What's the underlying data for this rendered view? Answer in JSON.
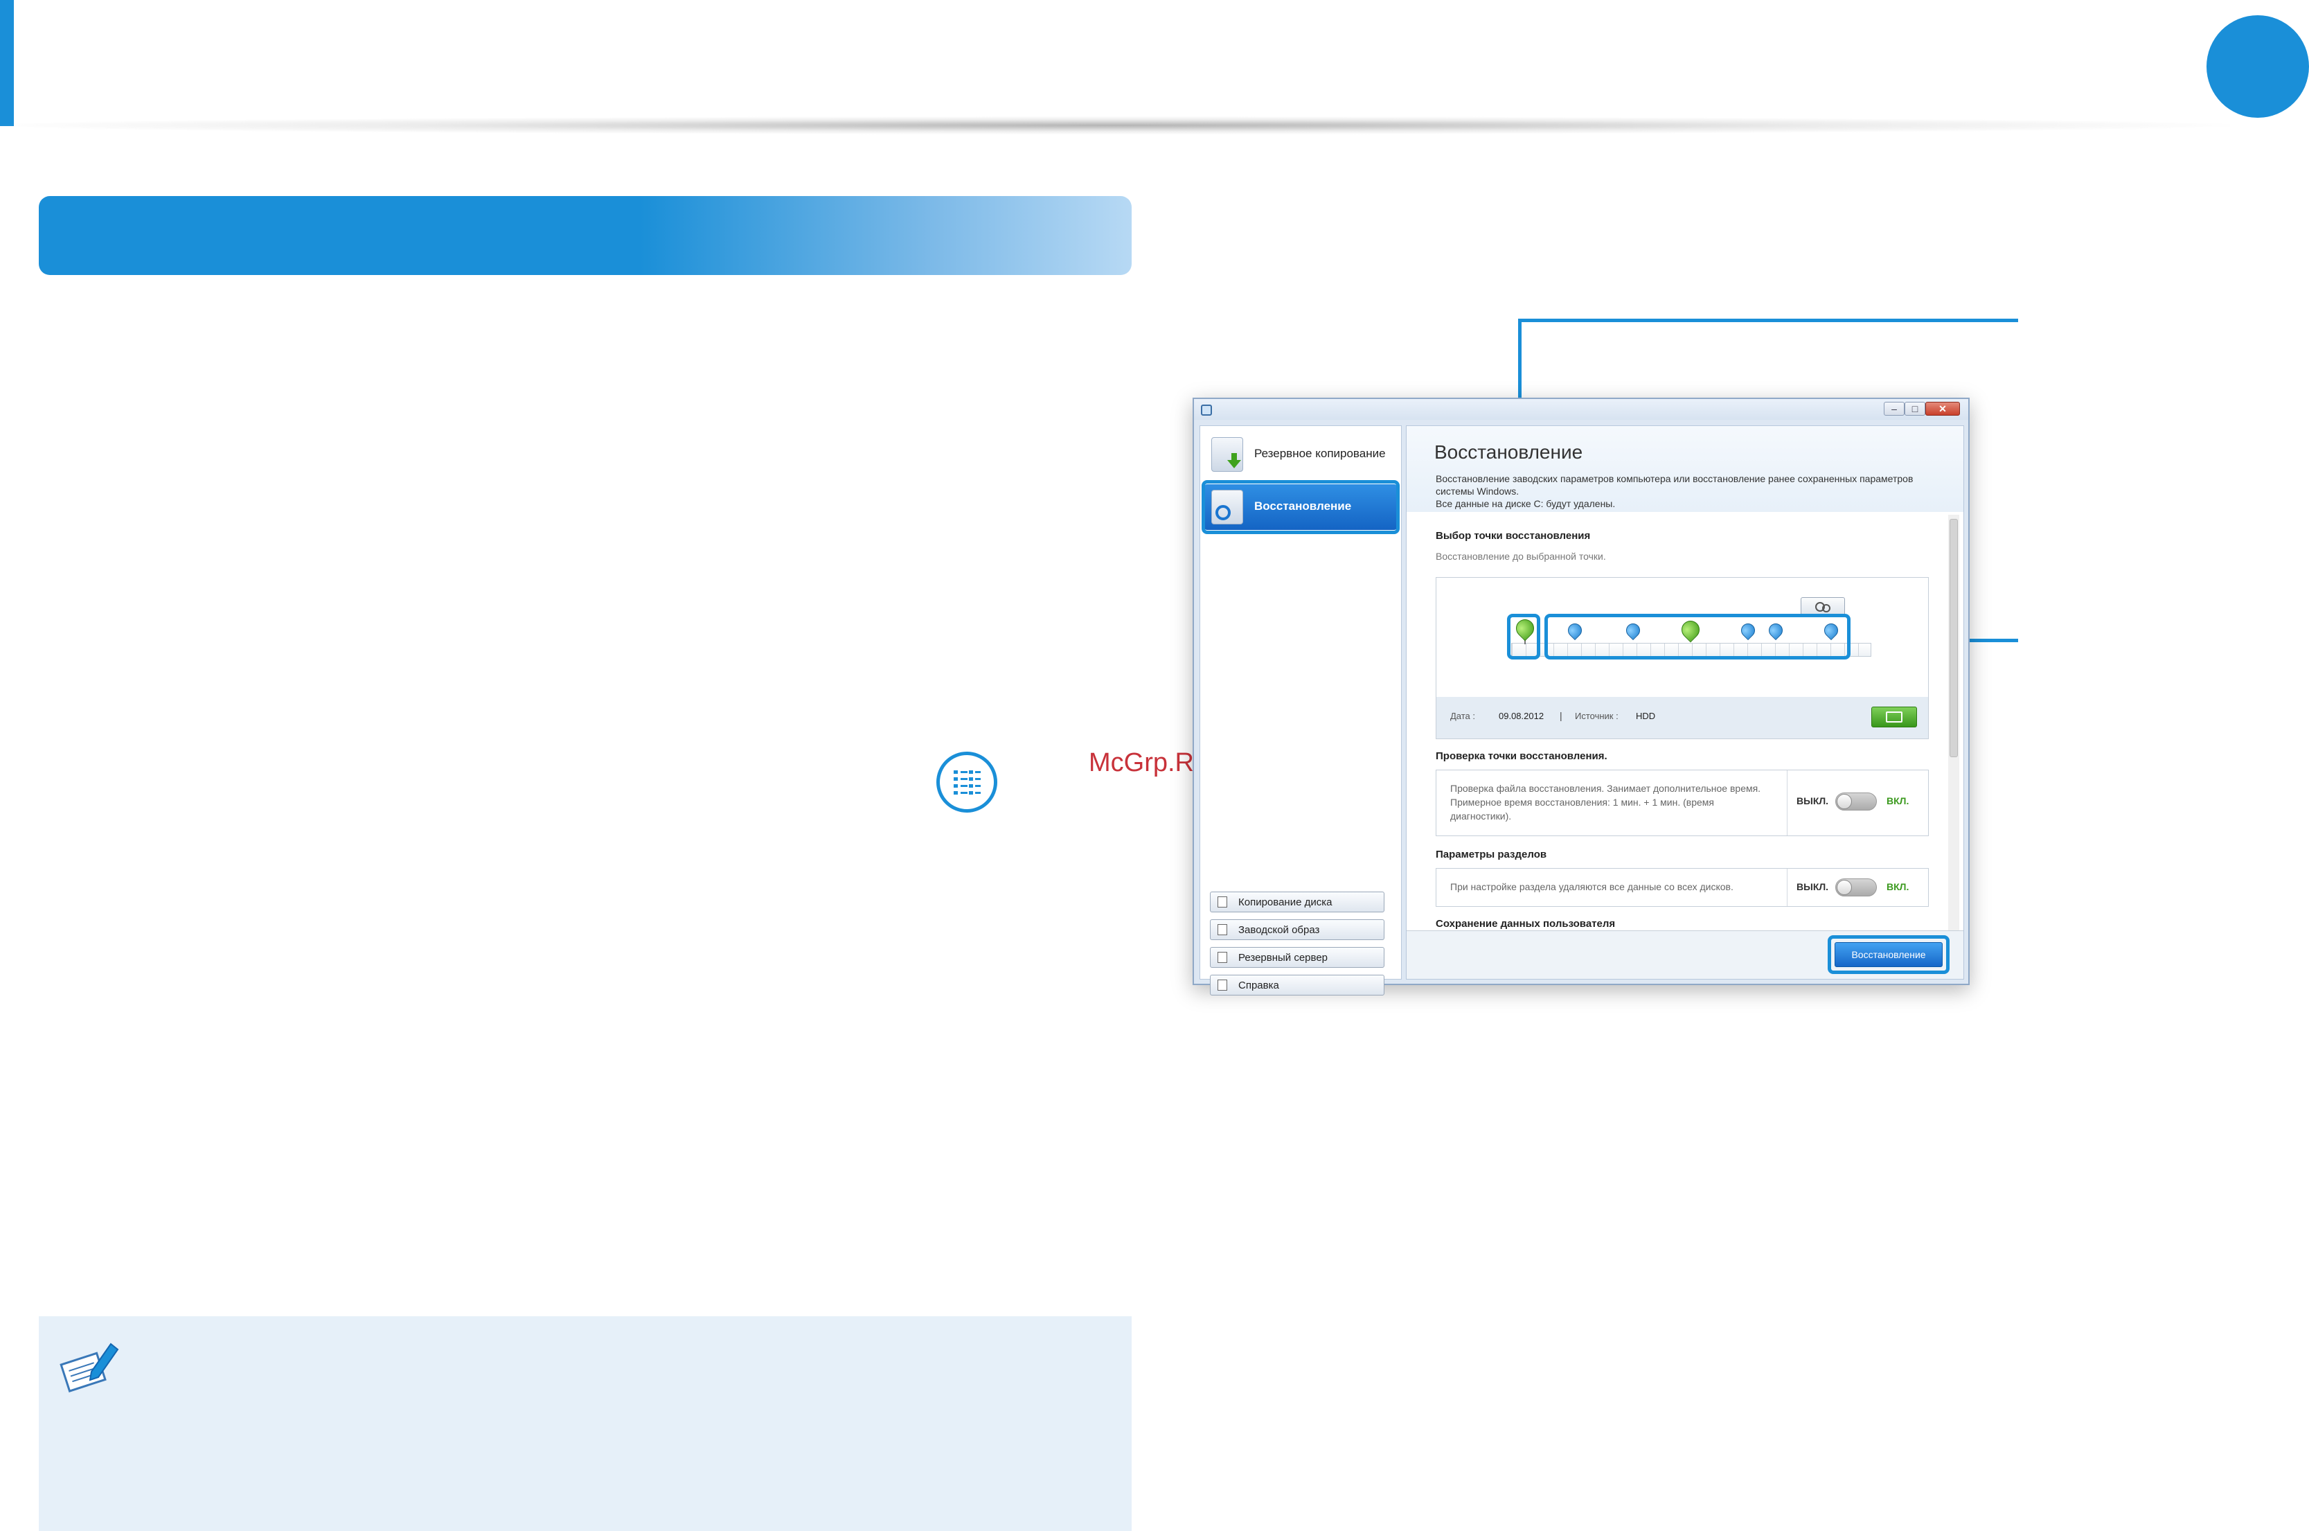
{
  "brand": {
    "accent_color": "#1a8fd8",
    "note_background": "#e6f0f9",
    "watermark_color": "#c8323a"
  },
  "watermark": "McGrp.Ru",
  "app": {
    "sidebar": {
      "nav": [
        {
          "label": "Резервное копирование",
          "icon": "backup-drive-icon"
        },
        {
          "label": "Восстановление",
          "icon": "restore-drive-icon",
          "selected": true
        }
      ],
      "buttons": [
        {
          "label": "Копирование диска",
          "icon": "disk-copy-icon"
        },
        {
          "label": "Заводской образ",
          "icon": "factory-image-icon"
        },
        {
          "label": "Резервный сервер",
          "icon": "backup-server-icon"
        },
        {
          "label": "Справка",
          "icon": "help-icon"
        }
      ]
    },
    "main": {
      "title": "Восстановление",
      "description": [
        "Восстановление заводских параметров компьютера или восстановление ранее сохраненных параметров",
        "системы Windows.",
        "Все данные на диске C: будут удалены."
      ],
      "restore_point": {
        "title": "Выбор точки восстановления",
        "subtitle": "Восстановление до выбранной точки.",
        "date_label": "Дата :",
        "date": "09.08.2012",
        "source_label": "Источник :",
        "source": "HDD"
      },
      "verify": {
        "title": "Проверка точки восстановления.",
        "text": [
          "Проверка файла восстановления. Занимает дополнительное время.",
          "Примерное время восстановления: 1 мин. + 1 мин. (время",
          "диагностики)."
        ],
        "off_label": "ВЫКЛ.",
        "on_label": "ВКЛ."
      },
      "partitions": {
        "title": "Параметры разделов",
        "text": "При настройке раздела удаляются все данные со всех дисков.",
        "off_label": "ВЫКЛ.",
        "on_label": "ВКЛ."
      },
      "user_data": {
        "title": "Сохранение данных пользователя"
      },
      "restore_button": "Восстановление"
    }
  }
}
